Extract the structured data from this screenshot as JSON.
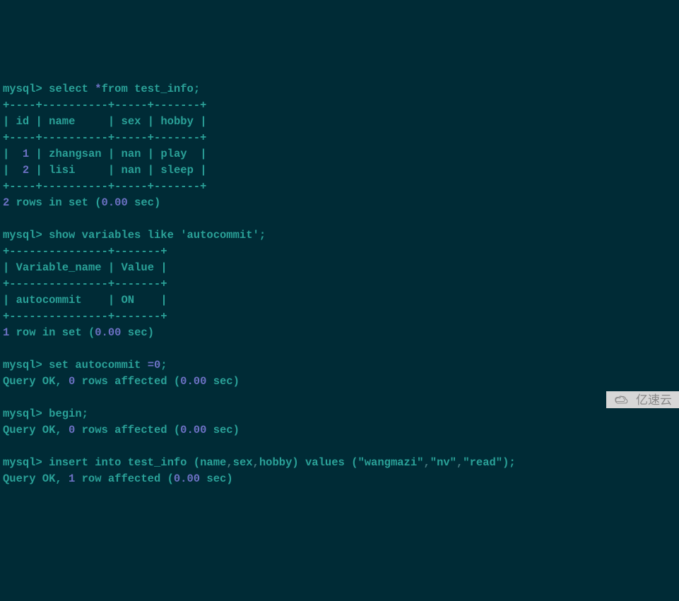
{
  "prompt_label": "mysql",
  "gt": ">",
  "queries": {
    "q1": "select",
    "q1_star": "*",
    "q1_from": "from test_info",
    "q2": "show variables like",
    "q2_str": "'autocommit'",
    "q3": "set autocommit",
    "q3_val": "=0",
    "q4": "begin",
    "q5": "insert into test_info",
    "q5_cols": "(name,sex,hobby)",
    "q5_values": "values",
    "q5_s1": "\"wangmazi\"",
    "q5_s2": "\"nv\"",
    "q5_s3": "\"read\"",
    "semi": ";"
  },
  "table1": {
    "border_top": "+----+----------+-----+-------+",
    "header": "| id | name     | sex | hobby |",
    "rows": [
      {
        "id": "1",
        "name": "zhangsan",
        "sex": "nan",
        "hobby": "play "
      },
      {
        "id": "2",
        "name": "lisi    ",
        "sex": "nan",
        "hobby": "sleep"
      }
    ]
  },
  "result1": {
    "count": "2",
    "text": " rows in set ",
    "time": "(0.00 sec)"
  },
  "table2": {
    "border_top": "+---------------+-------+",
    "header": "| Variable_name | Value |",
    "row": "| autocommit    | ON    |"
  },
  "result2": {
    "count": "1",
    "text": " row in set ",
    "time": "(0.00 sec)"
  },
  "ok1": {
    "pre": "Query OK, ",
    "n": "0",
    "post": " rows affected ",
    "time": "(0.00 sec)"
  },
  "ok2": {
    "pre": "Query OK, ",
    "n": "0",
    "post": " rows affected ",
    "time": "(0.00 sec)"
  },
  "ok3": {
    "pre": "Query OK, ",
    "n": "1",
    "post": " row affected ",
    "time": "(0.00 sec)"
  },
  "watermark": "亿速云"
}
